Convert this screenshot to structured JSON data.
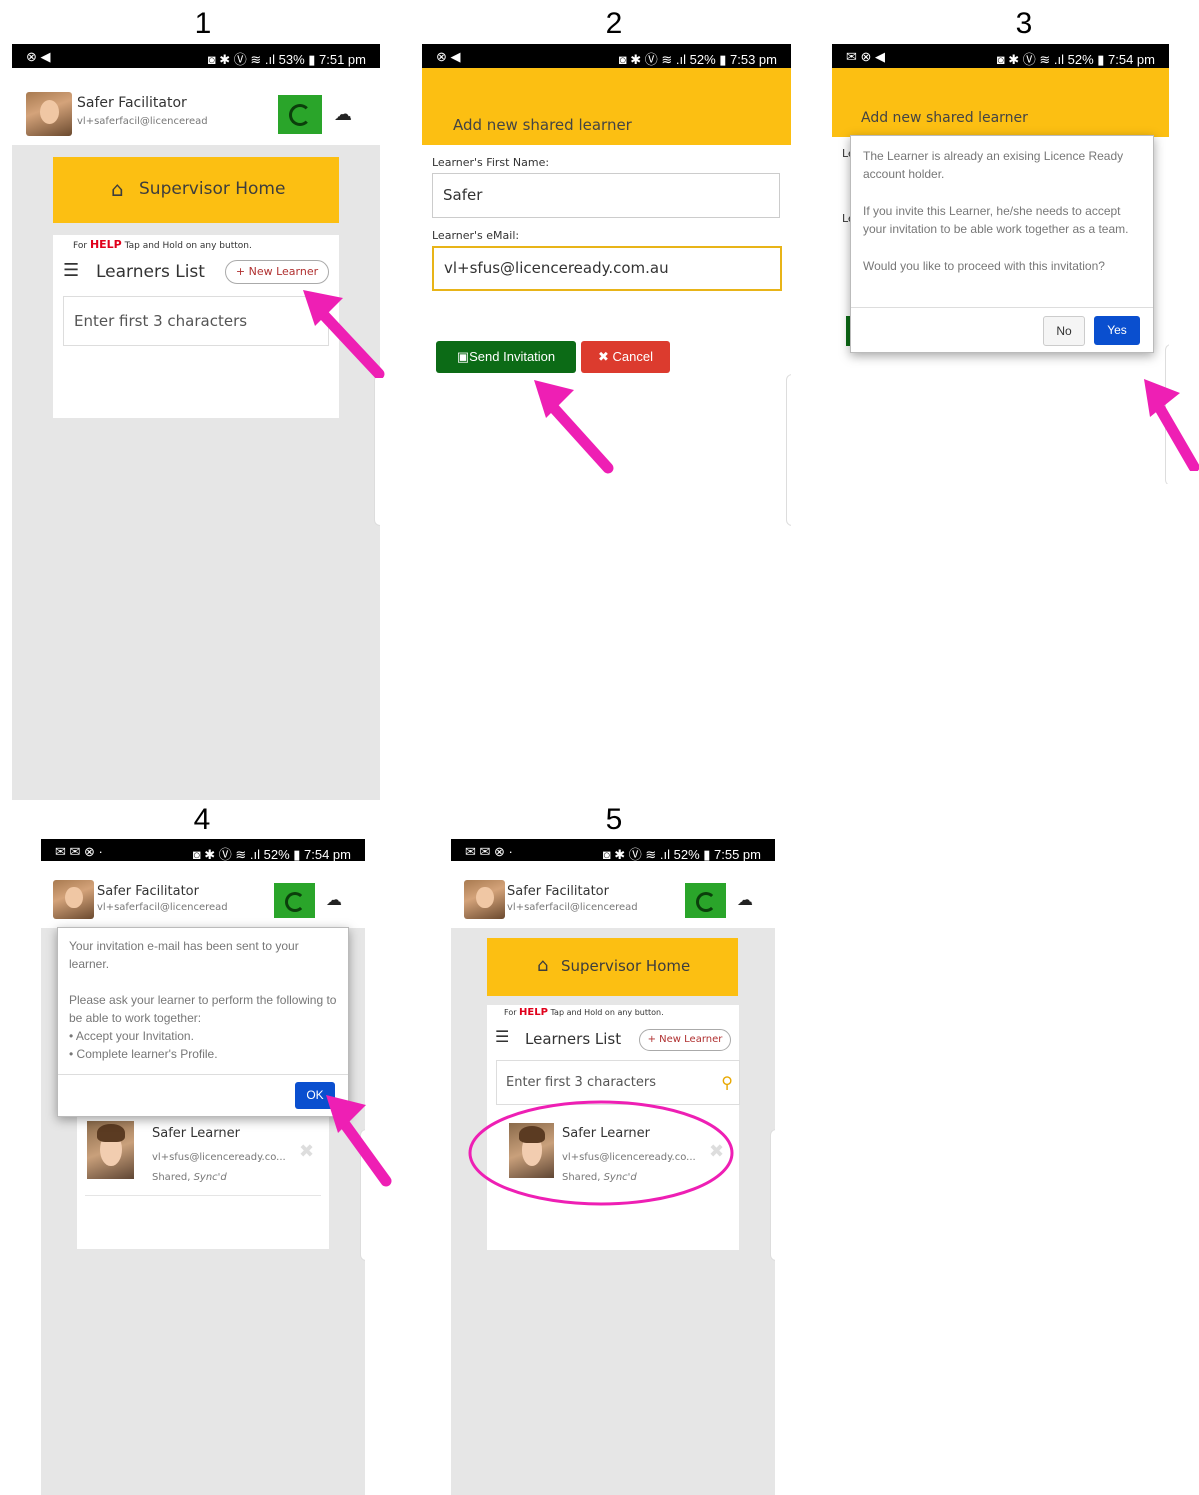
{
  "steps": [
    "1",
    "2",
    "3",
    "4",
    "5"
  ],
  "colors": {
    "accent_yellow": "#fcbf12",
    "sync_green": "#2aa52a",
    "arrow_pink": "#ee1fb4",
    "send_green": "#0c6b16",
    "cancel_red": "#dc3b2e",
    "yes_blue": "#0a4fcf"
  },
  "screen1": {
    "status_left": "⊗ ◀",
    "status_right": "◙ ✱ Ⓥ ≋ .ıl 53% ▮ 7:51 pm",
    "user_name": "Safer Facilitator",
    "user_email": "vl+saferfacil@licenceread",
    "home_label": "Supervisor Home",
    "help_prefix": "For ",
    "help_word": "HELP",
    "help_suffix": " Tap and Hold on any button.",
    "list_title": "Learners List",
    "new_learner": "+ New Learner",
    "search_placeholder": "Enter first 3 characters"
  },
  "screen2": {
    "status_left": "⊗ ◀",
    "status_right": "◙ ✱ Ⓥ ≋ .ıl 52% ▮ 7:53 pm",
    "title": "Add new shared learner",
    "first_name_label": "Learner's First Name:",
    "first_name_value": "Safer",
    "email_label": "Learner's eMail:",
    "email_value": "vl+sfus@licenceready.com.au",
    "send_label": "Send Invitation",
    "cancel_label": "Cancel"
  },
  "screen3": {
    "status_left": "✉ ⊗ ◀",
    "status_right": "◙ ✱ Ⓥ ≋ .ıl 52% ▮ 7:54 pm",
    "title": "Add new shared learner",
    "msg1": "The Learner is already an exising Licence Ready account holder.",
    "msg2": "If you invite this Learner, he/she needs to accept your invitation to be able work together as a team.",
    "msg3": "Would you like to proceed with this invitation?",
    "no_label": "No",
    "yes_label": "Yes",
    "behind_label_1": "Le",
    "behind_label_2": "Le"
  },
  "screen4": {
    "status_left": "✉ ✉ ⊗ ·",
    "status_right": "◙ ✱ Ⓥ ≋ .ıl 52% ▮ 7:54 pm",
    "user_name": "Safer Facilitator",
    "user_email": "vl+saferfacil@licenceread",
    "msg1": "Your invitation e-mail has been sent to your learner.",
    "msg2": "Please ask your learner to perform the following to be able to work together:",
    "bullet1": "• Accept your Invitation.",
    "bullet2": "• Complete learner's Profile.",
    "ok_label": "OK",
    "learner_name": "Safer Learner",
    "learner_email": "vl+sfus@licenceready.co...",
    "learner_status_prefix": "Shared, ",
    "learner_status_sync": "Sync'd"
  },
  "screen5": {
    "status_left": "✉ ✉ ⊗ ·",
    "status_right": "◙ ✱ Ⓥ ≋ .ıl 52% ▮ 7:55 pm",
    "user_name": "Safer Facilitator",
    "user_email": "vl+saferfacil@licenceread",
    "home_label": "Supervisor Home",
    "help_prefix": "For ",
    "help_word": "HELP",
    "help_suffix": " Tap and Hold on any button.",
    "list_title": "Learners List",
    "new_learner": "+ New Learner",
    "search_placeholder": "Enter first 3 characters",
    "learner_name": "Safer Learner",
    "learner_email": "vl+sfus@licenceready.co...",
    "learner_status_prefix": "Shared, ",
    "learner_status_sync": "Sync'd"
  },
  "icons": {
    "home": "home-icon",
    "list": "list-icon",
    "cloud": "cloud-sync-icon",
    "save": "save-icon",
    "close": "close-icon",
    "search": "search-icon",
    "arrow": "pointer-arrow-icon"
  }
}
